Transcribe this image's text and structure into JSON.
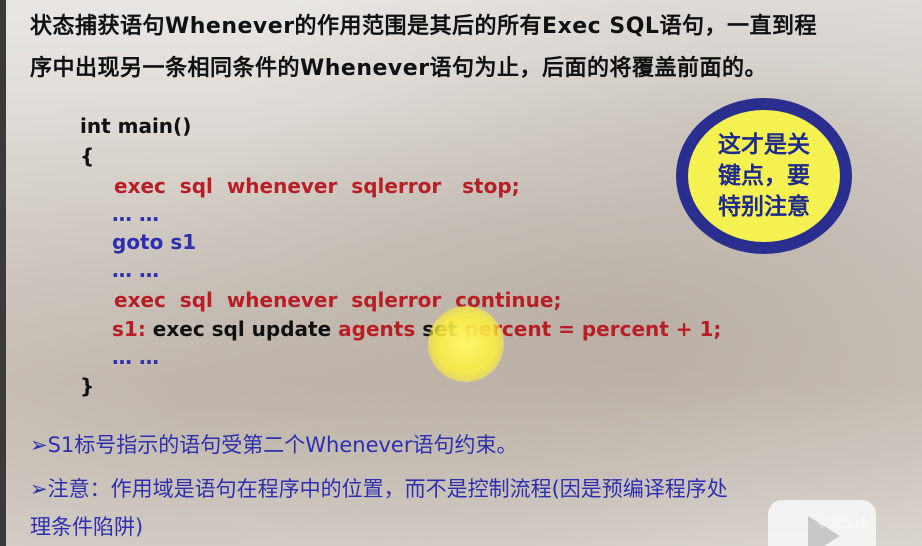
{
  "slide": {
    "title_line1": "状态捕获语句Whenever的作用范围是其后的所有Exec SQL语句，一直到程",
    "title_line2": "序中出现另一条相同条件的Whenever语句为止，后面的将覆盖前面的。",
    "code": {
      "l1": "int main()",
      "l2": "{",
      "l3": "exec  sql  whenever  sqlerror   stop;",
      "l4": "… …",
      "l5": "goto s1",
      "l6": "… …",
      "l7": "exec  sql  whenever  sqlerror  continue;",
      "l8_label": "s1:",
      "l8_black1": " exec sql update ",
      "l8_red1": "agents",
      "l8_black2": " set ",
      "l8_red2": "percent = percent + 1;",
      "l9": "… …",
      "l10": "}"
    },
    "callout": "这才是关键点，要特别注意",
    "notes": {
      "n1": "➢S1标号指示的语句受第二个Whenever语句约束。",
      "n2": "➢注意：作用域是语句在程序中的位置，而不是控制流程(因是预编译程序处",
      "n3": "理条件陷阱)"
    },
    "watermark": "学堂在线"
  },
  "colors": {
    "code_red": "#b81e25",
    "code_blue": "#2d2fb0",
    "callout_ring": "#2a2f8f",
    "callout_fill": "#f4f150"
  }
}
